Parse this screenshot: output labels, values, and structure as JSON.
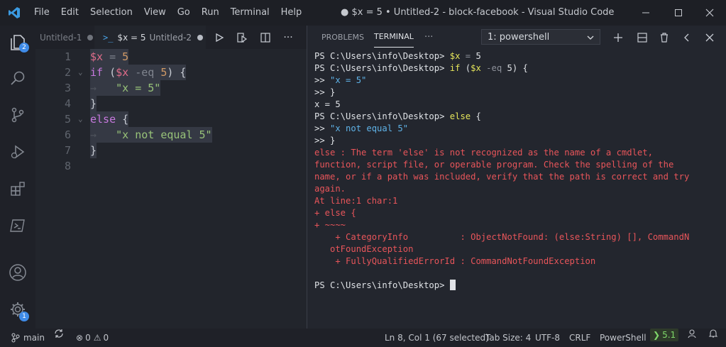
{
  "menu": [
    "File",
    "Edit",
    "Selection",
    "View",
    "Go",
    "Run",
    "Terminal",
    "Help"
  ],
  "window_title": "● $x = 5 • Untitled-2 - block-facebook - Visual Studio Code",
  "activity_badges": {
    "explorer": "2",
    "settings": "1"
  },
  "tabs": [
    {
      "label": "Untitled-1"
    },
    {
      "prefix": "$x = 5",
      "label": "Untitled-2"
    }
  ],
  "code_lines": [
    {
      "n": "1"
    },
    {
      "n": "2"
    },
    {
      "n": "3"
    },
    {
      "n": "4"
    },
    {
      "n": "5"
    },
    {
      "n": "6"
    },
    {
      "n": "7"
    },
    {
      "n": "8"
    }
  ],
  "code_tokens": {
    "l1": [
      "$x",
      " = ",
      "5"
    ],
    "l2": [
      "if",
      " (",
      "$x",
      " -eq ",
      "5",
      ") {"
    ],
    "l3": [
      "\"x = 5\""
    ],
    "l4": [
      "}"
    ],
    "l5": [
      "else",
      " {"
    ],
    "l6": [
      "\"x not equal 5\""
    ],
    "l7": [
      "}"
    ]
  },
  "panel": {
    "tabs": [
      "PROBLEMS",
      "TERMINAL",
      "···"
    ],
    "terminal_select": "1: powershell"
  },
  "terminal": {
    "l1": [
      "PS C:\\Users\\info\\Desktop> ",
      "$x",
      " = ",
      "5"
    ],
    "l2": [
      "PS C:\\Users\\info\\Desktop> ",
      "if",
      " (",
      "$x",
      " -eq ",
      "5",
      ") {"
    ],
    "l3": [
      ">> ",
      "\"x = 5\""
    ],
    "l4": ">> }",
    "l5": "x = 5",
    "l6": [
      "PS C:\\Users\\info\\Desktop> ",
      "else",
      " {"
    ],
    "l7": [
      ">> ",
      "\"x not equal 5\""
    ],
    "l8": ">> }",
    "errors": [
      "else : The term 'else' is not recognized as the name of a cmdlet,",
      "function, script file, or operable program. Check the spelling of the",
      "name, or if a path was included, verify that the path is correct and try",
      "again.",
      "At line:1 char:1",
      "+ else {",
      "+ ~~~~",
      "    + CategoryInfo          : ObjectNotFound: (else:String) [], CommandN",
      "   otFoundException",
      "    + FullyQualifiedErrorId : CommandNotFoundException"
    ],
    "prompt": "PS C:\\Users\\info\\Desktop> "
  },
  "status": {
    "branch": "main",
    "errors": "0",
    "warnings": "0",
    "position": "Ln 8, Col 1 (67 selected)",
    "tab_size": "Tab Size: 4",
    "encoding": "UTF-8",
    "eol": "CRLF",
    "language": "PowerShell",
    "ps_version": "5.1"
  }
}
